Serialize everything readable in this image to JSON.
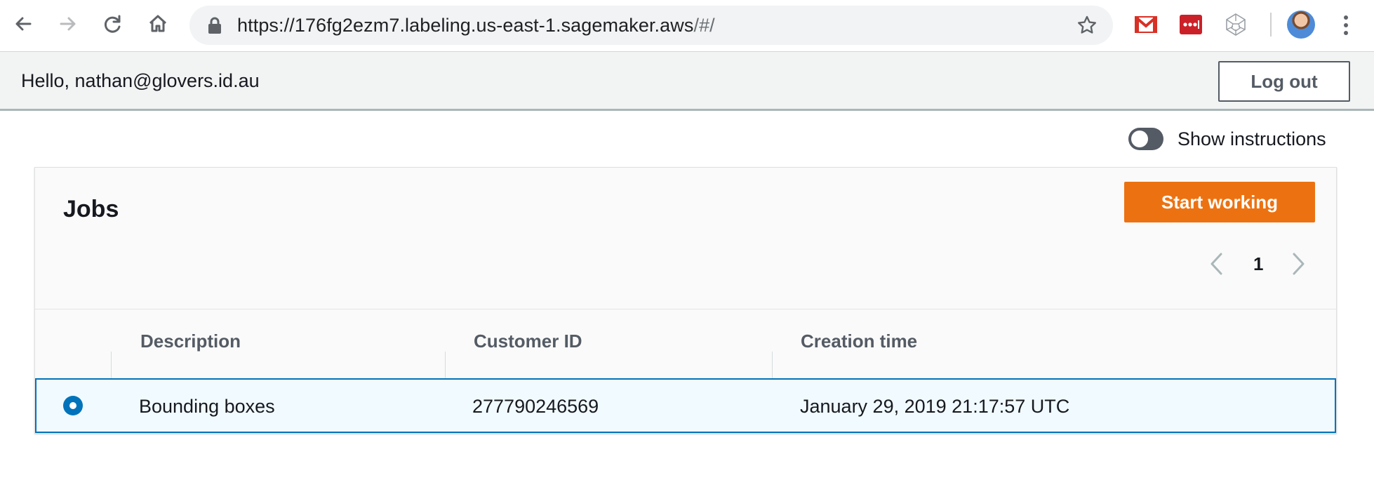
{
  "browser": {
    "url_main": "https://176fg2ezm7.labeling.us-east-1.sagemaker.aws",
    "url_hash": "/#/",
    "icons": [
      "back-arrow-icon",
      "forward-arrow-icon",
      "reload-icon",
      "home-icon",
      "lock-icon",
      "bookmark-star-icon",
      "gmail-icon",
      "lastpass-icon",
      "extension-polygon-icon",
      "profile-avatar",
      "menu-kebab-icon"
    ]
  },
  "header": {
    "greeting": "Hello, nathan@glovers.id.au",
    "logout_label": "Log out"
  },
  "instructions_toggle": {
    "label": "Show instructions",
    "on": false
  },
  "jobs": {
    "title": "Jobs",
    "start_label": "Start working",
    "page": "1",
    "columns": [
      "Description",
      "Customer ID",
      "Creation time"
    ],
    "rows": [
      {
        "selected": true,
        "description": "Bounding boxes",
        "customer_id": "277790246569",
        "creation_time": "January 29, 2019 21:17:57 UTC"
      }
    ]
  },
  "colors": {
    "primary_button": "#ec7211",
    "selection_border": "#0073bb",
    "selection_bg": "#f1faff",
    "header_bg": "#f2f3f3"
  }
}
